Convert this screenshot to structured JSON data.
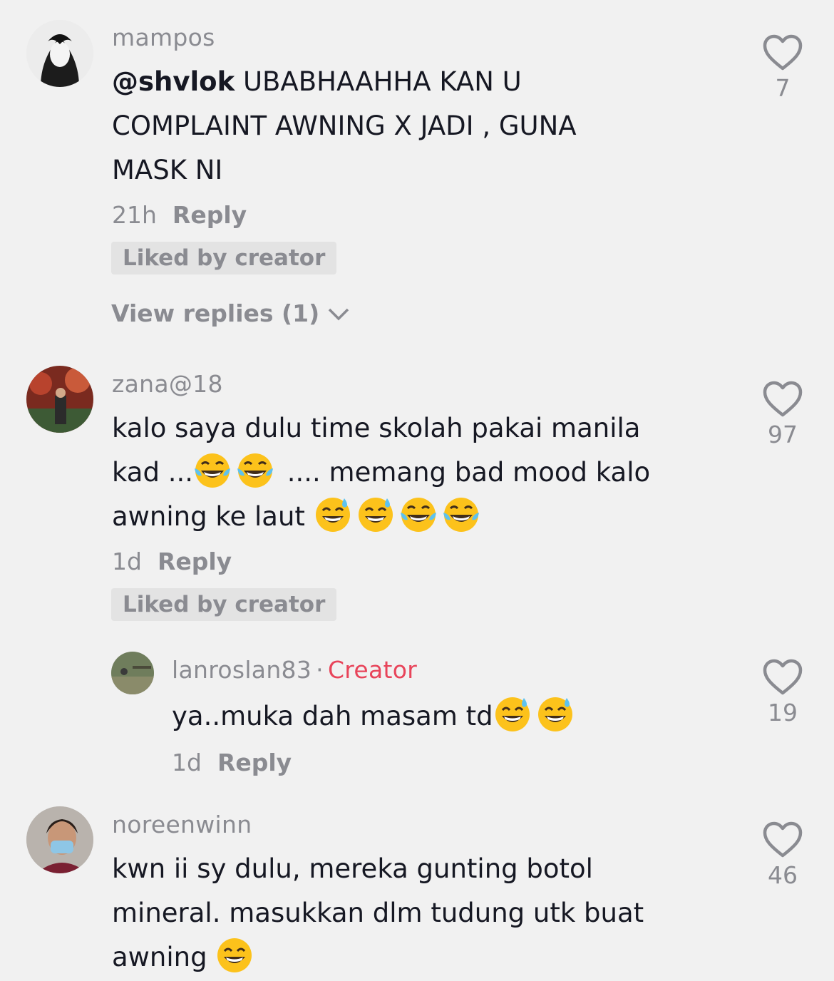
{
  "comments": [
    {
      "username": "mampos",
      "mention": "@shvlok",
      "lines": [
        " UBABHAAHHA KAN U",
        "COMPLAINT AWNING X JADI , GUNA",
        "MASK NI"
      ],
      "time": "21h",
      "reply_label": "Reply",
      "badge": "Liked by creator",
      "view_replies": "View replies (1)",
      "likes": "7"
    },
    {
      "username": "zana@18",
      "lines_a": "kalo saya dulu time skolah pakai manila",
      "line_b_pre": "kad ...",
      "line_b_post": " .... memang bad mood kalo",
      "line_c": "awning ke laut ",
      "time": "1d",
      "reply_label": "Reply",
      "badge": "Liked by creator",
      "likes": "97"
    },
    {
      "username": "lanroslan83",
      "separator": "·",
      "creator_tag": "Creator",
      "text": "ya..muka dah masam td",
      "time": "1d",
      "reply_label": "Reply",
      "likes": "19"
    },
    {
      "username": "noreenwinn",
      "lines": [
        "kwn ii sy dulu, mereka gunting botol",
        "mineral. masukkan dlm tudung utk buat",
        "awning "
      ],
      "likes": "46"
    }
  ],
  "icons": {
    "heart": "heart-outline-icon",
    "chevron": "chevron-down-icon",
    "emoji_laugh": "tears-of-joy-emoji",
    "emoji_sweat": "grinning-sweat-emoji",
    "emoji_grin": "beaming-grin-emoji"
  },
  "colors": {
    "background": "#f1f1f1",
    "text": "#161823",
    "secondary": "#8a8b91",
    "creator": "#e8445a"
  }
}
